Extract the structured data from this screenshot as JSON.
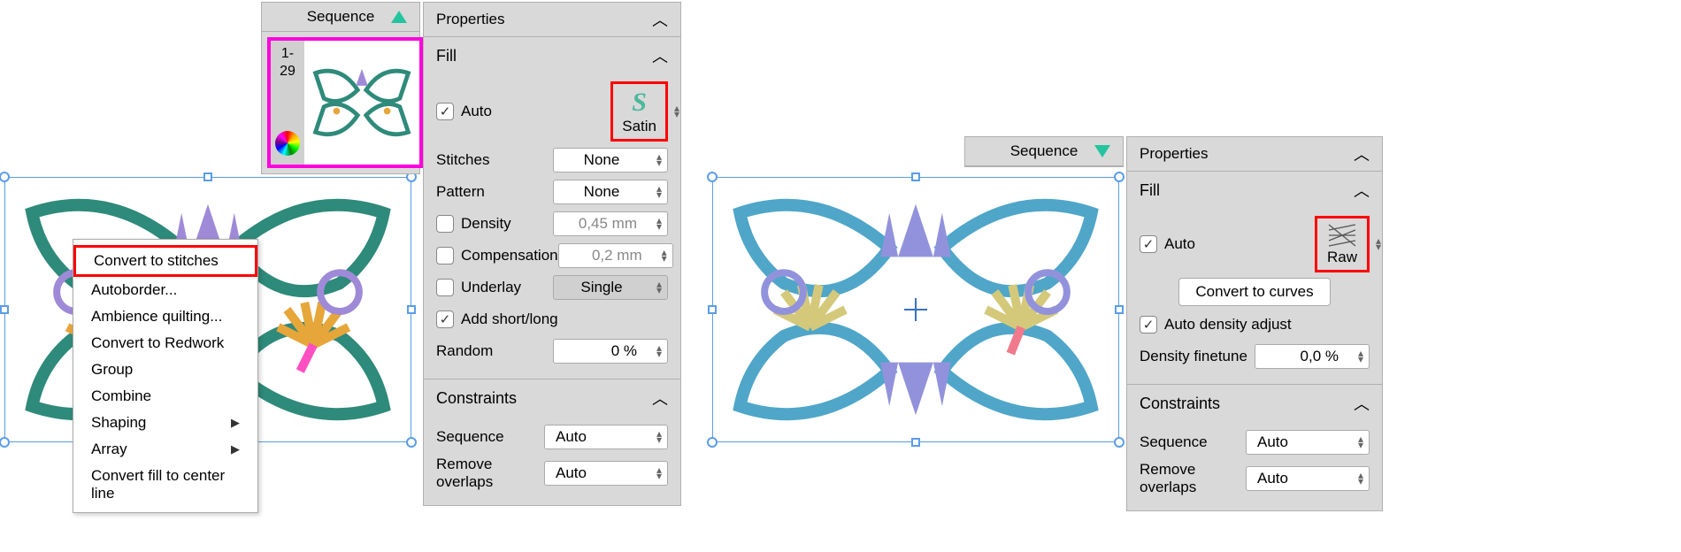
{
  "left": {
    "sequence": {
      "title": "Sequence",
      "range_from": "1-",
      "range_to": "29"
    },
    "context_menu": {
      "items": [
        "Convert to stitches",
        "Autoborder...",
        "Ambience quilting...",
        "Convert to Redwork",
        "Group",
        "Combine",
        "Shaping",
        "Array",
        "Convert fill to center line"
      ]
    },
    "properties": {
      "title": "Properties",
      "fill": {
        "title": "Fill",
        "auto_label": "Auto",
        "type_label": "Satin",
        "stitches_label": "Stitches",
        "stitches_value": "None",
        "pattern_label": "Pattern",
        "pattern_value": "None",
        "density_label": "Density",
        "density_value": "0,45 mm",
        "compensation_label": "Compensation",
        "compensation_value": "0,2 mm",
        "underlay_label": "Underlay",
        "underlay_value": "Single",
        "short_long_label": "Add short/long",
        "random_label": "Random",
        "random_value": "0 %"
      },
      "constraints": {
        "title": "Constraints",
        "sequence_label": "Sequence",
        "sequence_value": "Auto",
        "remove_label": "Remove overlaps",
        "remove_value": "Auto"
      }
    }
  },
  "right": {
    "sequence": {
      "title": "Sequence"
    },
    "properties": {
      "title": "Properties",
      "fill": {
        "title": "Fill",
        "auto_label": "Auto",
        "type_label": "Raw",
        "convert_btn": "Convert to curves",
        "adj_label": "Auto density adjust",
        "finetune_label": "Density finetune",
        "finetune_value": "0,0 %"
      },
      "constraints": {
        "title": "Constraints",
        "sequence_label": "Sequence",
        "sequence_value": "Auto",
        "remove_label": "Remove overlaps",
        "remove_value": "Auto"
      }
    }
  }
}
